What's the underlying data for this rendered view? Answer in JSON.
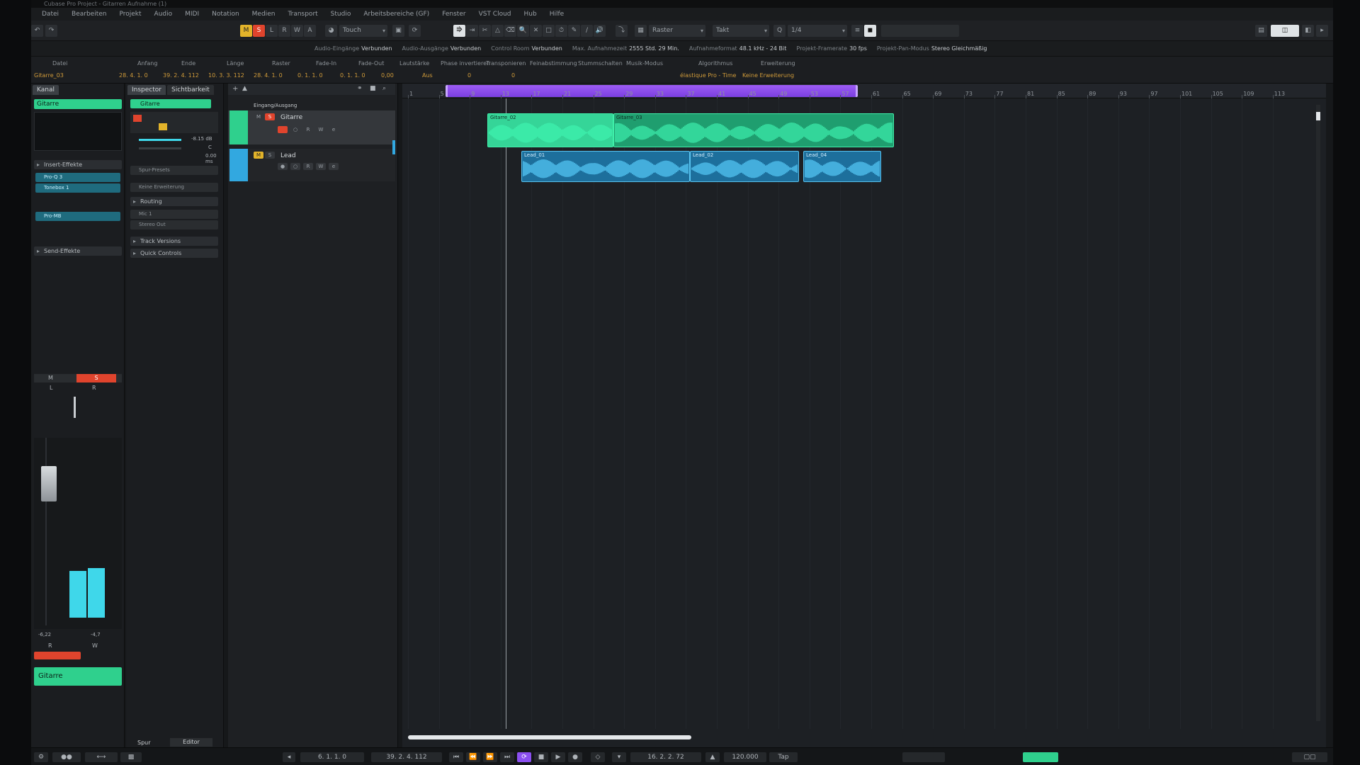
{
  "window": {
    "title": "Cubase Pro Project - Gitarren Aufnahme (1)"
  },
  "menu": [
    "Datei",
    "Bearbeiten",
    "Projekt",
    "Audio",
    "MIDI",
    "Notation",
    "Medien",
    "Transport",
    "Studio",
    "Arbeitsbereiche (GF)",
    "Fenster",
    "VST Cloud",
    "Hub",
    "Hilfe"
  ],
  "toolbar": {
    "mode_m": "M",
    "mode_s": "S",
    "mode_l": "L",
    "mode_r": "R",
    "mode_w": "W",
    "mode_a": "A",
    "automation": "Touch",
    "snap": "Raster",
    "grid": "Takt",
    "quantize": "1/4"
  },
  "statusline": [
    {
      "label": "Audio-Eingänge",
      "value": "Verbunden"
    },
    {
      "label": "Audio-Ausgänge",
      "value": "Verbunden"
    },
    {
      "label": "Control Room",
      "value": "Verbunden"
    },
    {
      "label": "Max. Aufnahmezeit",
      "value": "2555 Std. 29 Min."
    },
    {
      "label": "Aufnahmeformat",
      "value": "48.1 kHz - 24 Bit"
    },
    {
      "label": "Projekt-Framerate",
      "value": "30 fps"
    },
    {
      "label": "Projekt-Pan-Modus",
      "value": "Stereo Gleichmäßig"
    }
  ],
  "infoline": [
    {
      "label": "Datei",
      "value": "Gitarre_03"
    },
    {
      "label": "Anfang",
      "value": "28. 4. 1. 0"
    },
    {
      "label": "Ende",
      "value": "39. 2. 4. 112"
    },
    {
      "label": "Länge",
      "value": "10. 3. 3. 112"
    },
    {
      "label": "Raster",
      "value": "28. 4. 1. 0"
    },
    {
      "label": "Fade-In",
      "value": "0. 1. 1. 0"
    },
    {
      "label": "Fade-Out",
      "value": "0. 1. 1. 0"
    },
    {
      "label": "Lautstärke",
      "value": "0,00"
    },
    {
      "label": "Phase invertieren",
      "value": "Aus"
    },
    {
      "label": "Transponieren",
      "value": "0"
    },
    {
      "label": "Feinabstimmung",
      "value": "0"
    },
    {
      "label": "Stummschalten",
      "value": ""
    },
    {
      "label": "Musik-Modus",
      "value": ""
    },
    {
      "label": "Algorithmus",
      "value": "élastique Pro - Time"
    },
    {
      "label": "Erweiterung",
      "value": "Keine Erweiterung"
    }
  ],
  "channel": {
    "tab": "Kanal",
    "name": "Gitarre",
    "inserts": "Insert-Effekte",
    "slots": [
      "Pro-Q 3",
      "Tonebox 1",
      "Pro-MB"
    ],
    "sends": "Send-Effekte",
    "footer": "Gitarre",
    "m": "M",
    "s": "S",
    "l": "L",
    "r": "R",
    "w": "W",
    "val_left": "-6,22",
    "val_right": "-4,7"
  },
  "inspector": {
    "tab1": "Inspector",
    "tab2": "Sichtbarkeit",
    "track": "Gitarre",
    "routing_in": "Spur-Presets",
    "edit_none": "Keine Erweiterung",
    "routing": "Routing",
    "in": "Mic 1",
    "out": "Stereo Out",
    "sections": [
      "Track Versions",
      "Quick Controls"
    ],
    "vol": "-8.15 dB",
    "pan": "C",
    "delay": "0.00 ms"
  },
  "tracklist": {
    "header": "Eingang/Ausgang",
    "tracks": [
      {
        "name": "Gitarre",
        "color": "#2fd08d"
      },
      {
        "name": "Lead",
        "color": "#32a8e0"
      }
    ]
  },
  "ruler": {
    "marks": [
      "1",
      "5",
      "9",
      "13",
      "17",
      "21",
      "25",
      "29",
      "33",
      "37",
      "41",
      "45",
      "49",
      "53",
      "57",
      "61",
      "65",
      "69",
      "73",
      "77",
      "81",
      "85",
      "89",
      "93",
      "97",
      "101",
      "105",
      "109",
      "113"
    ]
  },
  "events": [
    {
      "name": "Gitarre_02",
      "track": 0
    },
    {
      "name": "Gitarre_03",
      "track": 0
    },
    {
      "name": "Lead_01",
      "track": 1
    },
    {
      "name": "Lead_02",
      "track": 1
    },
    {
      "name": "Lead_04",
      "track": 1
    }
  ],
  "bottom_tabs": {
    "spur": "Spur",
    "editor": "Editor"
  },
  "transport": {
    "left": "6. 1. 1. 0",
    "right": "39. 2. 4. 112",
    "pos": "16. 2. 2. 72",
    "tempo": "120.000",
    "sig": "Tap"
  },
  "colors": {
    "accent": "#2fd08d",
    "lead": "#32a8e0",
    "cycle": "#8b4ff0",
    "record": "#e0442d",
    "mode_yellow": "#e2b32a"
  }
}
